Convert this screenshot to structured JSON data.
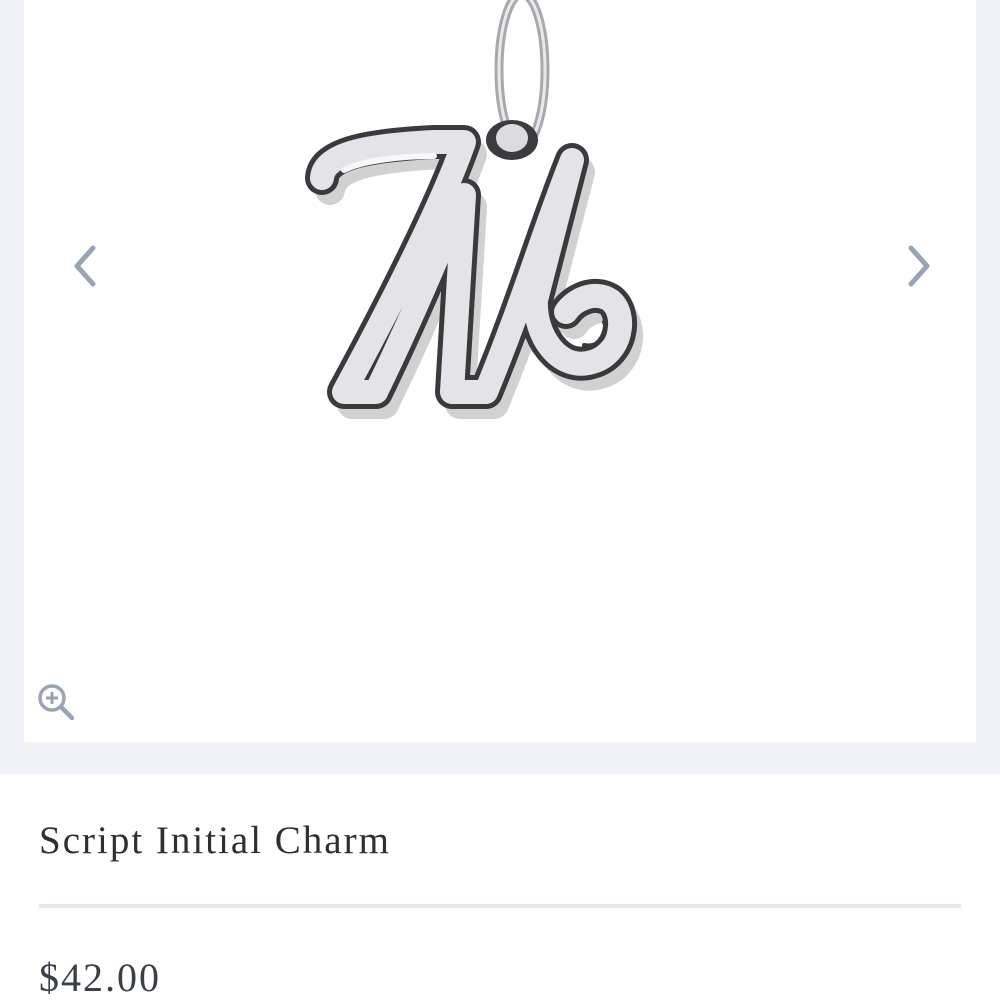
{
  "gallery": {
    "image_alt": "Script Initial Charm",
    "prev_icon": "chevron-left-icon",
    "next_icon": "chevron-right-icon",
    "zoom_icon": "zoom-in-icon"
  },
  "product": {
    "title": "Script Initial Charm",
    "price": "$42.00"
  },
  "colors": {
    "page_background": "#f0f2f7",
    "card_background": "#ffffff",
    "icon": "#9aa3b5",
    "text": "#2e2e33"
  }
}
